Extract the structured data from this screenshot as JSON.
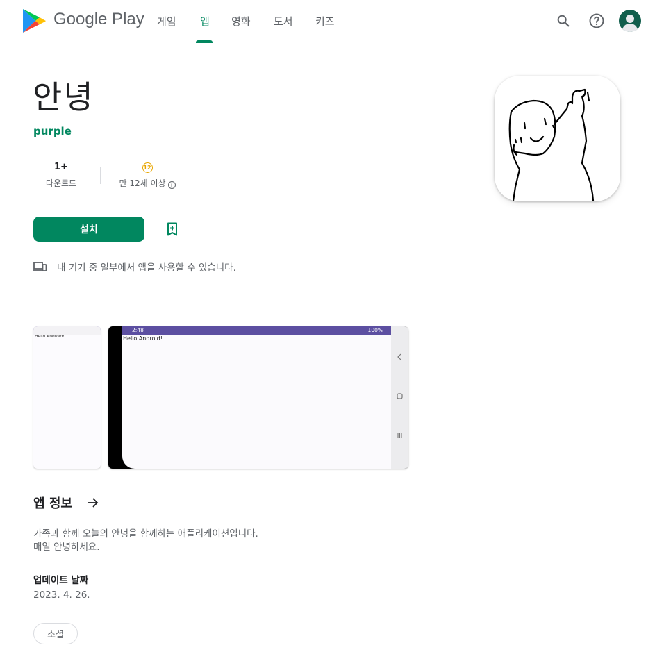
{
  "header": {
    "brand": "Google Play",
    "nav": [
      {
        "label": "게임",
        "active": false
      },
      {
        "label": "앱",
        "active": true
      },
      {
        "label": "영화",
        "active": false
      },
      {
        "label": "도서",
        "active": false
      },
      {
        "label": "키즈",
        "active": false
      }
    ],
    "icons": [
      "search-icon",
      "help-icon",
      "account-avatar"
    ],
    "accent_color": "#01875f"
  },
  "app": {
    "title": "안녕",
    "developer": "purple",
    "downloads_value": "1+",
    "downloads_label": "다운로드",
    "rating_badge": "12",
    "rating_label": "만 12세 이상",
    "install_label": "설치",
    "device_note": "내 기기 중 일부에서 앱을 사용할 수 있습니다."
  },
  "screenshots": {
    "phone": {
      "hello": "Hello Android!"
    },
    "tablet": {
      "time": "2:48",
      "battery": "100%",
      "hello": "Hello Android!"
    }
  },
  "about": {
    "title": "앱 정보",
    "description_line1": "가족과 함께 오늘의 안녕을 함께하는 애플리케이션입니다.",
    "description_line2": "매일 안녕하세요.",
    "updated_label": "업데이트 날짜",
    "updated_date": "2023. 4. 26.",
    "category_chip": "소셜"
  }
}
